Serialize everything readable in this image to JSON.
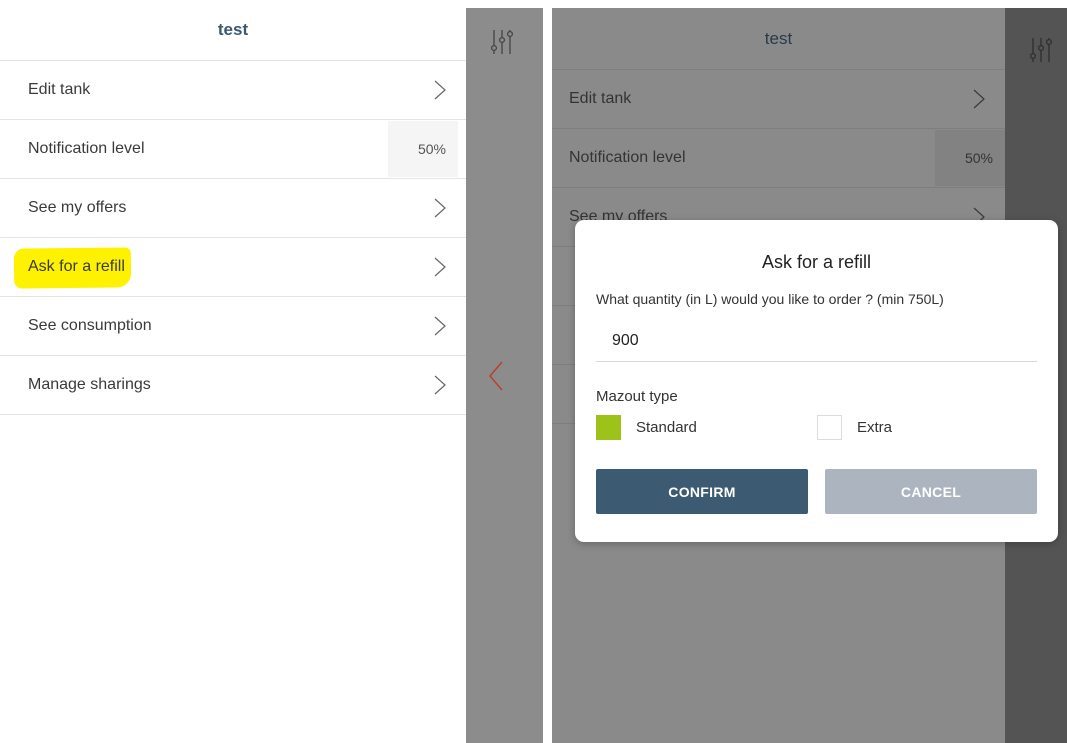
{
  "left_screen": {
    "title": "test",
    "menu": [
      {
        "label": "Edit tank",
        "kind": "chevron"
      },
      {
        "label": "Notification level",
        "kind": "value",
        "value": "50%"
      },
      {
        "label": "See my offers",
        "kind": "chevron"
      },
      {
        "label": "Ask for a refill",
        "kind": "chevron",
        "highlighted": true
      },
      {
        "label": "See consumption",
        "kind": "chevron"
      },
      {
        "label": "Manage sharings",
        "kind": "chevron"
      }
    ],
    "highlight_color": "#fff200"
  },
  "right_screen": {
    "title": "test",
    "menu": [
      {
        "label": "Edit tank"
      },
      {
        "label": "Notification level",
        "value": "50%"
      },
      {
        "label": "See my offers"
      }
    ]
  },
  "icons": {
    "filter": "sliders-icon",
    "back": "chevron-left-icon",
    "row": "chevron-right-icon"
  },
  "modal": {
    "title": "Ask for a refill",
    "question": "What quantity (in L) would you like to order ? (min 750L)",
    "quantity_value": "900",
    "type_label": "Mazout type",
    "options": [
      {
        "label": "Standard",
        "checked": true
      },
      {
        "label": "Extra",
        "checked": false
      }
    ],
    "confirm_label": "CONFIRM",
    "cancel_label": "CANCEL"
  },
  "colors": {
    "primary": "#3d5a73",
    "accent_green": "#9dc21a",
    "back_chevron": "#c0392b",
    "cancel": "#acb5bf"
  }
}
